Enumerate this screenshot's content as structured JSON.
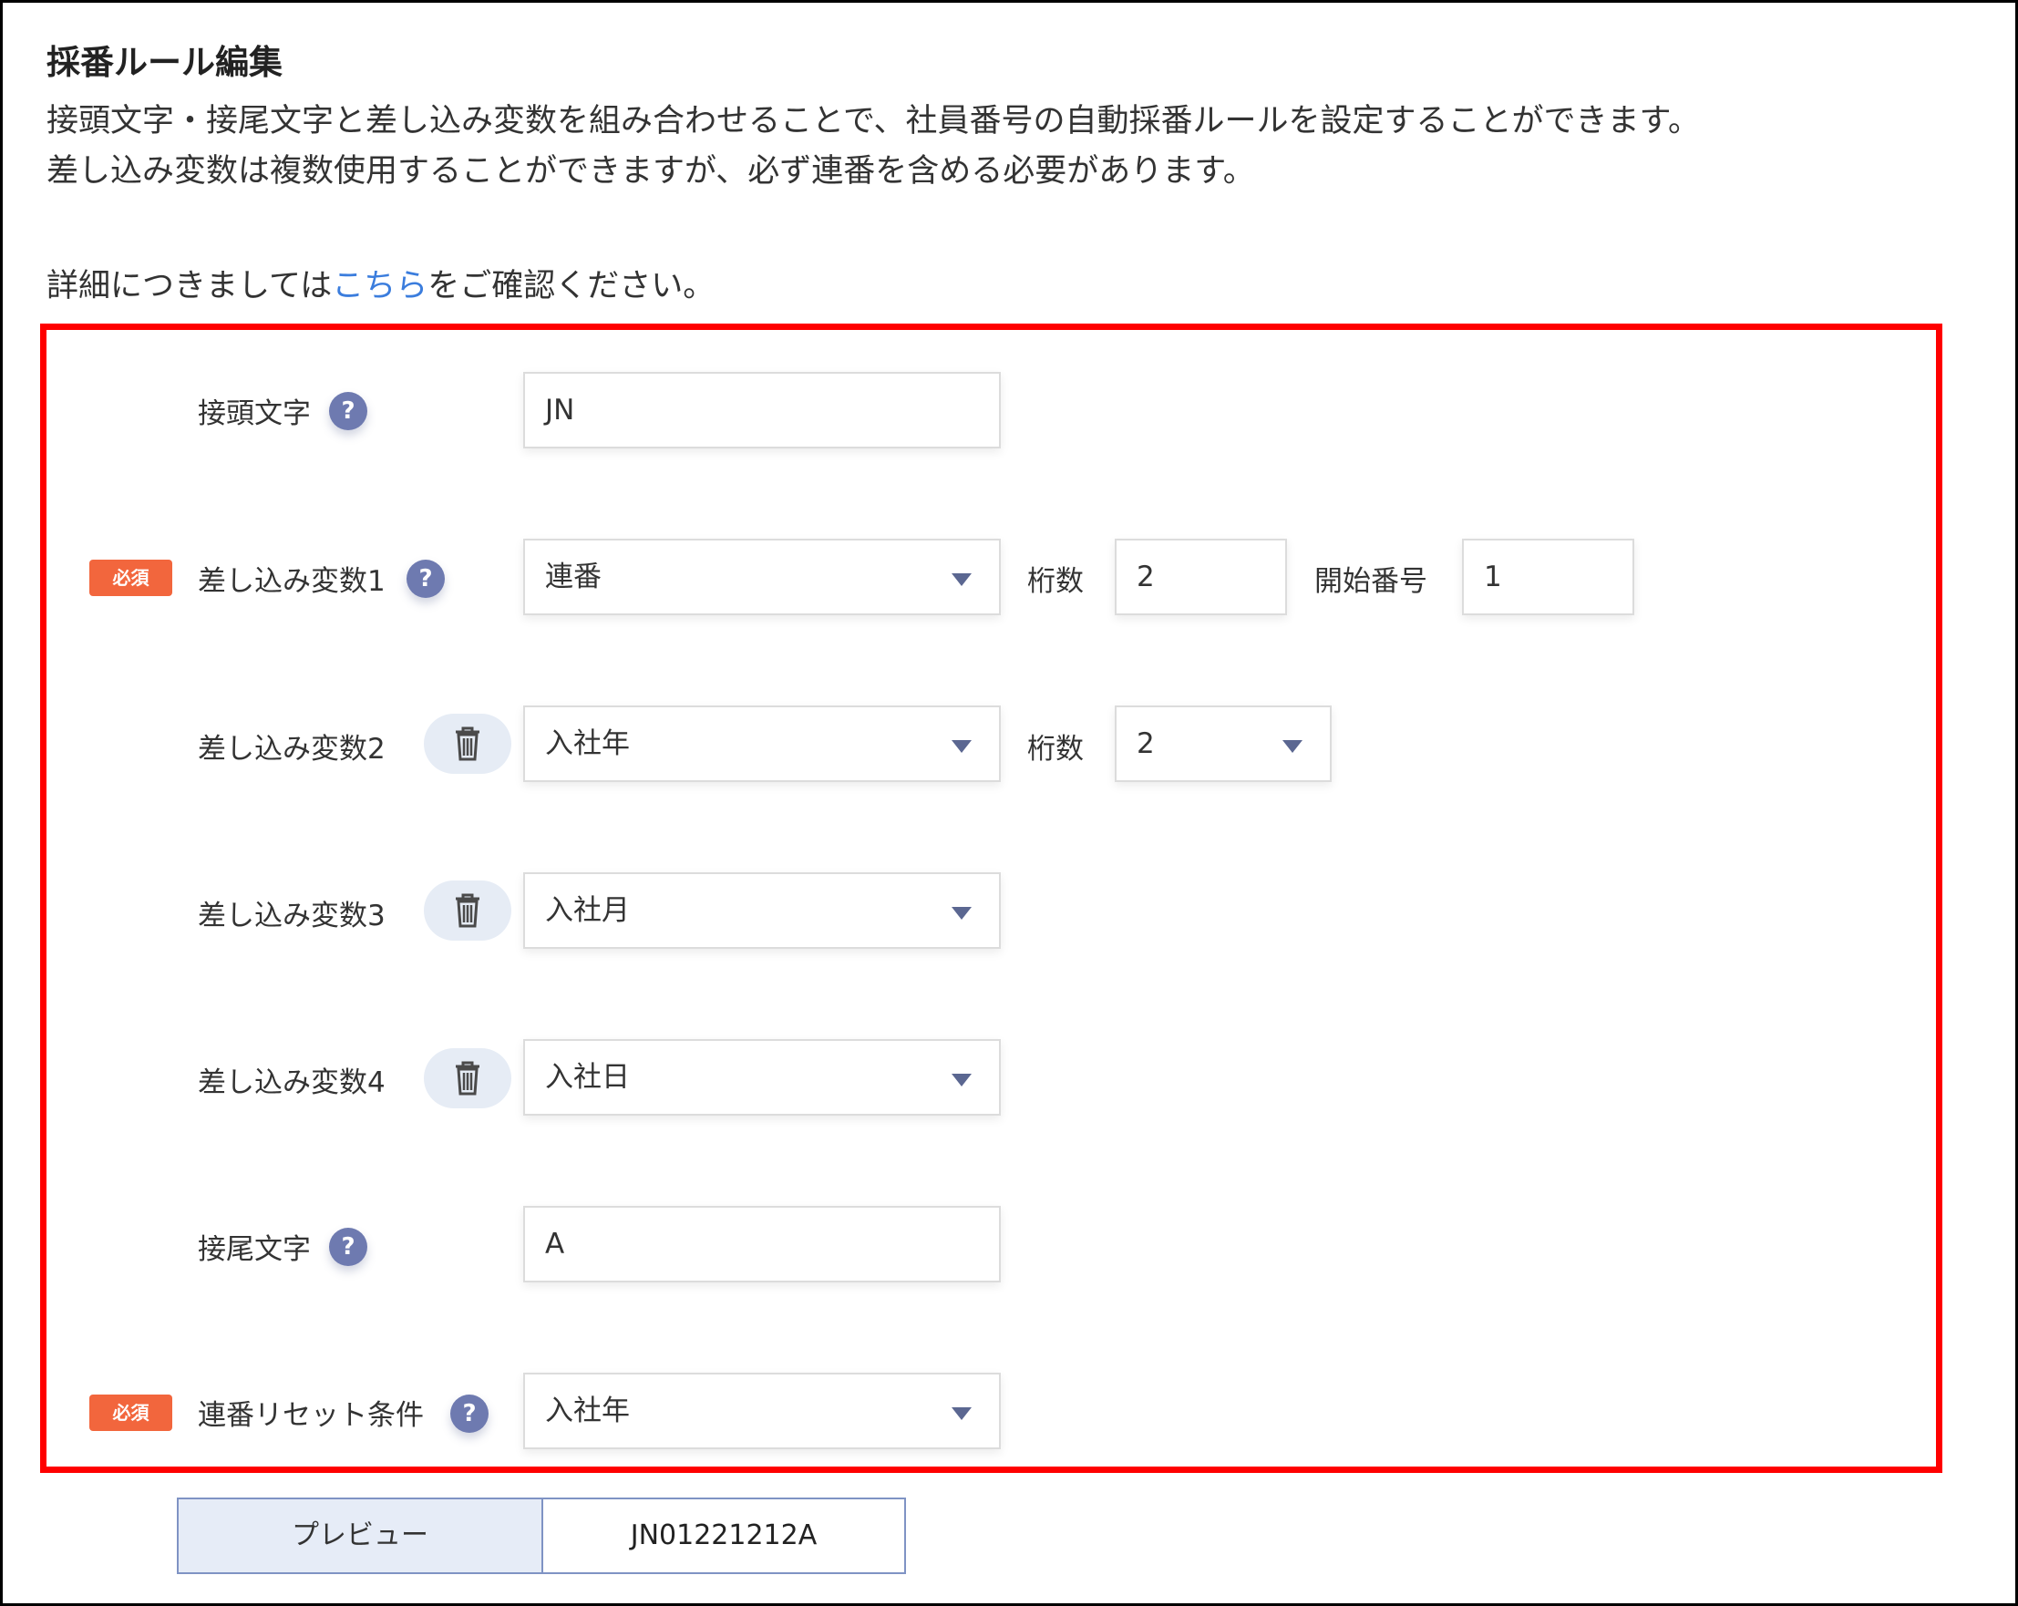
{
  "header": {
    "title": "採番ルール編集",
    "desc_line1": "接頭文字・接尾文字と差し込み変数を組み合わせることで、社員番号の自動採番ルールを設定することができます。",
    "desc_line2": "差し込み変数は複数使用することができますが、必ず連番を含める必要があります。",
    "detail_prefix": "詳細につきましては",
    "detail_link": "こちら",
    "detail_suffix": "をご確認ください。"
  },
  "badges": {
    "required": "必須"
  },
  "help_icon_text": "?",
  "prefix": {
    "label": "接頭文字",
    "value": "JN"
  },
  "var1": {
    "label": "差し込み変数1",
    "value": "連番",
    "digits_label": "桁数",
    "digits_value": "2",
    "start_label": "開始番号",
    "start_value": "1"
  },
  "var2": {
    "label": "差し込み変数2",
    "value": "入社年",
    "digits_label": "桁数",
    "digits_value": "2"
  },
  "var3": {
    "label": "差し込み変数3",
    "value": "入社月"
  },
  "var4": {
    "label": "差し込み変数4",
    "value": "入社日"
  },
  "suffix": {
    "label": "接尾文字",
    "value": "A"
  },
  "reset": {
    "label": "連番リセット条件",
    "value": "入社年"
  },
  "preview": {
    "label": "プレビュー",
    "value": "JN01221212A"
  },
  "colors": {
    "highlight_border": "#ff0000",
    "required_badge": "#f2663d",
    "help_icon": "#6e7ab0",
    "link": "#3b7ddd"
  },
  "icons": {
    "help": "question-circle-icon",
    "delete": "trash-icon",
    "dropdown": "caret-down-icon"
  }
}
